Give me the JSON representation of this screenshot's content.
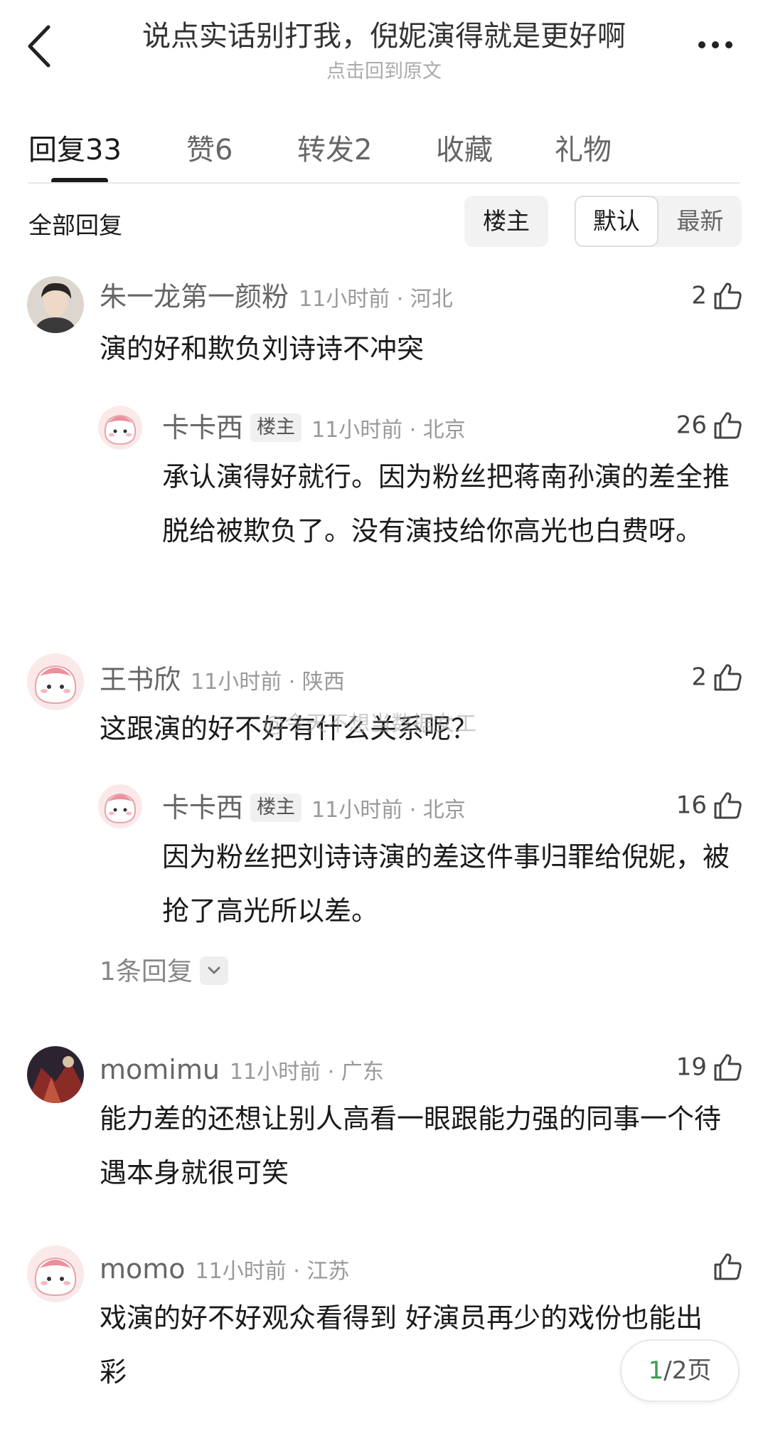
{
  "header": {
    "title": "说点实话别打我，倪妮演得就是更好啊",
    "subtitle": "点击回到原文"
  },
  "tabs": [
    {
      "label": "回复",
      "count": "33"
    },
    {
      "label": "赞",
      "count": "6"
    },
    {
      "label": "转发",
      "count": "2"
    },
    {
      "label": "收藏",
      "count": ""
    },
    {
      "label": "礼物",
      "count": ""
    }
  ],
  "filter": {
    "label": "全部回复",
    "owner_only": "楼主",
    "sort_default": "默认",
    "sort_latest": "最新"
  },
  "comments": [
    {
      "user": "朱一龙第一颜粉",
      "time_location": "11小时前 · 河北",
      "likes": "2",
      "text": "演的好和欺负刘诗诗不冲突",
      "avatar": "portrait-avatar"
    },
    {
      "user": "卡卡西",
      "badge": "楼主",
      "time_location": "11小时前 · 北京",
      "likes": "26",
      "text": "承认演得好就行。因为粉丝把蒋南孙演的差全推脱给被欺负了。没有演技给你高光也白费呀。",
      "avatar": "pink-cartoon-avatar"
    },
    {
      "user": "王书欣",
      "time_location": "11小时前 · 陕西",
      "likes": "2",
      "text": "这跟演的好不好有什么关系呢？",
      "avatar": "pink-cartoon-avatar"
    },
    {
      "user": "卡卡西",
      "badge": "楼主",
      "time_location": "11小时前 · 北京",
      "likes": "16",
      "text": "因为粉丝把刘诗诗演的差这件事归罪给倪妮，被抢了高光所以差。",
      "avatar": "pink-cartoon-avatar"
    },
    {
      "user": "momimu",
      "time_location": "11小时前 · 广东",
      "likes": "19",
      "text": "能力差的还想让别人高看一眼跟能力强的同事一个待遇本身就很可笑",
      "avatar": "dark-red-avatar"
    },
    {
      "user": "momo",
      "time_location": "11小时前 · 江苏",
      "likes": "",
      "text": "戏演的好不好观众看得到 好演员再少的戏份也能出彩",
      "avatar": "pink-cartoon-avatar"
    }
  ],
  "more_replies": "1条回复",
  "pager": {
    "current": "1",
    "total": "/2页"
  },
  "watermark": "@今天不想当数据女工",
  "colors": {
    "accent_green": "#3d9a52",
    "text_gray": "#666666",
    "time_gray": "#999999"
  },
  "icons": [
    "back-arrow-icon",
    "more-dots-icon",
    "thumbs-up-icon",
    "chevron-down-icon"
  ]
}
